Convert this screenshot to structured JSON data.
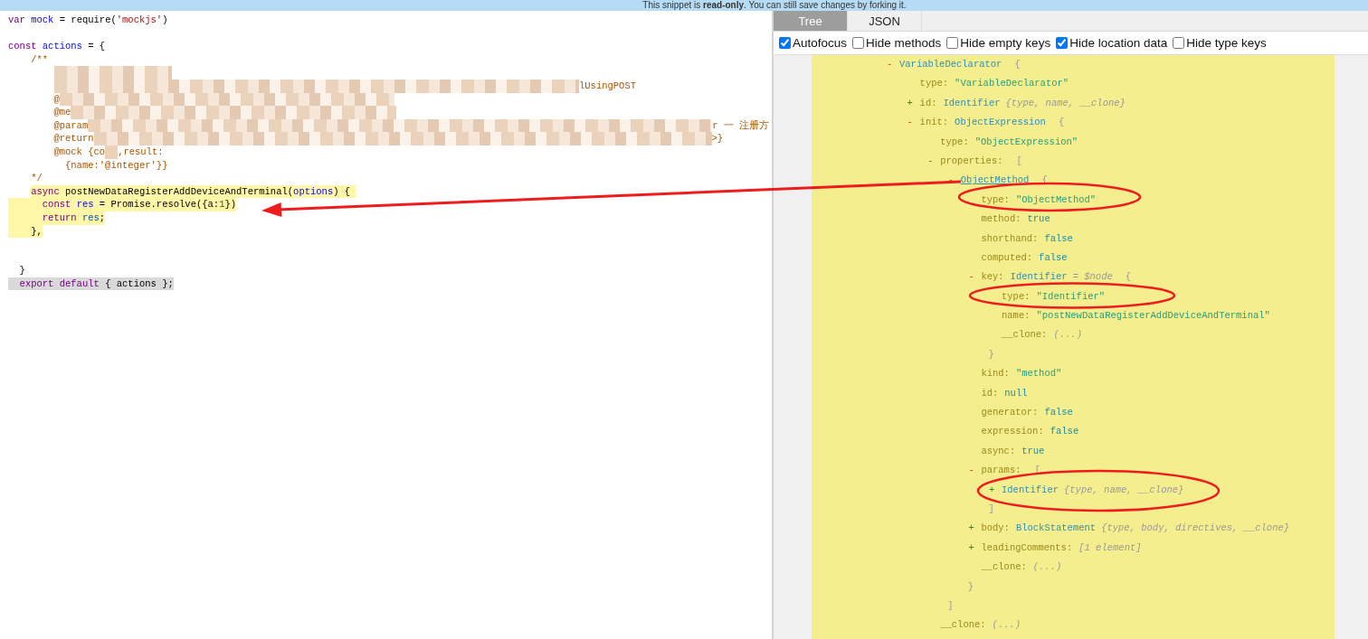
{
  "banner": {
    "text": "This snippet is **read-only**. You can still save changes by forking it."
  },
  "editor": {
    "lines": [
      {
        "kind": "code",
        "tokens": [
          {
            "kind": "keyword",
            "text": "var "
          },
          {
            "kind": "def",
            "text": "mock"
          },
          {
            "kind": "plain",
            "text": " = require("
          },
          {
            "kind": "string",
            "text": "'mockjs'"
          },
          {
            "kind": "plain",
            "text": ")"
          }
        ]
      },
      {
        "kind": "blank"
      },
      {
        "kind": "code",
        "tokens": [
          {
            "kind": "keyword",
            "text": "const "
          },
          {
            "kind": "def",
            "text": "actions"
          },
          {
            "kind": "plain",
            "text": " = {"
          }
        ]
      },
      {
        "kind": "code",
        "tokens": [
          {
            "kind": "comment",
            "text": "    /**"
          }
        ]
      },
      {
        "kind": "code",
        "tokens": [
          {
            "kind": "redacted"
          }
        ]
      },
      {
        "kind": "code",
        "tokens": [
          {
            "kind": "redacted"
          },
          {
            "kind": "comment",
            "text": "lUsingPOST"
          }
        ]
      },
      {
        "kind": "code",
        "tokens": [
          {
            "kind": "comment",
            "text": "        @"
          },
          {
            "kind": "redacted"
          }
        ]
      },
      {
        "kind": "code",
        "tokens": [
          {
            "kind": "comment",
            "text": "        @me"
          },
          {
            "kind": "redacted"
          }
        ]
      },
      {
        "kind": "code",
        "tokens": [
          {
            "kind": "comment",
            "text": "        @param"
          },
          {
            "kind": "redacted"
          },
          {
            "kind": "comment",
            "text": "r 一 注册方"
          }
        ]
      },
      {
        "kind": "code",
        "tokens": [
          {
            "kind": "comment",
            "text": "        @return"
          },
          {
            "kind": "redacted"
          },
          {
            "kind": "comment",
            "text": ">}"
          }
        ]
      },
      {
        "kind": "code",
        "tokens": [
          {
            "kind": "comment",
            "text": "        @mock {co"
          },
          {
            "kind": "redacted"
          },
          {
            "kind": "comment",
            "text": ",result:"
          }
        ]
      },
      {
        "kind": "code",
        "tokens": [
          {
            "kind": "comment",
            "text": "          {name:'@integer'}}"
          }
        ]
      },
      {
        "kind": "code",
        "tokens": [
          {
            "kind": "comment",
            "text": "    */"
          }
        ]
      },
      {
        "kind": "highlight",
        "tokens": [
          {
            "kind": "keyword",
            "text": "    async"
          },
          {
            "kind": "plain",
            "text": " postNewDataRegisterAddDeviceAndTerminal("
          },
          {
            "kind": "def",
            "text": "options"
          },
          {
            "kind": "plain",
            "text": ") { "
          }
        ]
      },
      {
        "kind": "highlight-full",
        "tokens": [
          {
            "kind": "keyword",
            "text": "      const "
          },
          {
            "kind": "def",
            "text": "res"
          },
          {
            "kind": "plain",
            "text": " = Promise.resolve({a:"
          },
          {
            "kind": "number",
            "text": "1"
          },
          {
            "kind": "plain",
            "text": "})"
          }
        ]
      },
      {
        "kind": "highlight-full",
        "tokens": [
          {
            "kind": "keyword",
            "text": "      return "
          },
          {
            "kind": "variable",
            "text": "res"
          },
          {
            "kind": "plain",
            "text": ";"
          }
        ]
      },
      {
        "kind": "highlight-full",
        "tokens": [
          {
            "kind": "plain",
            "text": "    },"
          }
        ]
      },
      {
        "kind": "blank"
      },
      {
        "kind": "blank"
      },
      {
        "kind": "code",
        "tokens": [
          {
            "kind": "plain",
            "text": "  }"
          }
        ]
      },
      {
        "kind": "selection",
        "tokens": [
          {
            "kind": "keyword",
            "text": "  export default"
          },
          {
            "kind": "plain",
            "text": " { actions };"
          }
        ]
      }
    ]
  },
  "tabs": [
    {
      "label": "Tree",
      "selected": true
    },
    {
      "label": "JSON",
      "selected": false
    }
  ],
  "options": [
    {
      "label": "Autofocus",
      "checked": true
    },
    {
      "label": "Hide methods",
      "checked": false
    },
    {
      "label": "Hide empty keys",
      "checked": false
    },
    {
      "label": "Hide location data",
      "checked": true
    },
    {
      "label": "Hide type keys",
      "checked": false
    }
  ],
  "tree": [
    {
      "toggle": "-",
      "expanded": true,
      "node_type": "VariableDeclarator",
      "open": "{",
      "children": [
        {
          "key": "type:",
          "value": "\"VariableDeclarator\"",
          "kind": "string"
        },
        {
          "toggle": "+",
          "expanded": false,
          "key": "id:",
          "node_type": "Identifier",
          "summary": "{type, name, __clone}"
        },
        {
          "toggle": "-",
          "expanded": true,
          "key": "init:",
          "node_type": "ObjectExpression",
          "open": "{",
          "children": [
            {
              "key": "type:",
              "value": "\"ObjectExpression\"",
              "kind": "string"
            },
            {
              "toggle": "-",
              "expanded": true,
              "key": "properties:",
              "open": "[",
              "close": "]",
              "children": [
                {
                  "toggle": "-",
                  "expanded": true,
                  "node_type": "ObjectMethod",
                  "hovered": true,
                  "open": "{",
                  "close": "}",
                  "children": [
                    {
                      "key": "type:",
                      "value": "\"ObjectMethod\"",
                      "kind": "string"
                    },
                    {
                      "key": "method:",
                      "value": "true",
                      "kind": "literal"
                    },
                    {
                      "key": "shorthand:",
                      "value": "false",
                      "kind": "literal"
                    },
                    {
                      "key": "computed:",
                      "value": "false",
                      "kind": "literal"
                    },
                    {
                      "toggle": "-",
                      "expanded": true,
                      "key": "key:",
                      "node_type": "Identifier",
                      "note": "= $node",
                      "open": "{",
                      "close": "}",
                      "children": [
                        {
                          "key": "type:",
                          "value": "\"Identifier\"",
                          "kind": "string"
                        },
                        {
                          "key": "name:",
                          "value": "\"postNewDataRegisterAddDeviceAndTerminal\"",
                          "kind": "string"
                        },
                        {
                          "key": "__clone:",
                          "value": "(...)",
                          "kind": "ellipsis"
                        }
                      ]
                    },
                    {
                      "key": "kind:",
                      "value": "\"method\"",
                      "kind": "string"
                    },
                    {
                      "key": "id:",
                      "value": "null",
                      "kind": "literal"
                    },
                    {
                      "key": "generator:",
                      "value": "false",
                      "kind": "literal"
                    },
                    {
                      "key": "expression:",
                      "value": "false",
                      "kind": "literal"
                    },
                    {
                      "key": "async:",
                      "value": "true",
                      "kind": "literal"
                    },
                    {
                      "toggle": "-",
                      "expanded": true,
                      "key": "params:",
                      "open": "[",
                      "close": "]",
                      "children": [
                        {
                          "toggle": "+",
                          "expanded": false,
                          "node_type": "Identifier",
                          "summary": "{type, name, __clone}"
                        }
                      ]
                    },
                    {
                      "toggle": "+",
                      "expanded": false,
                      "key": "body:",
                      "node_type": "BlockStatement",
                      "summary": "{type, body, directives, __clone}"
                    },
                    {
                      "toggle": "+",
                      "expanded": false,
                      "key": "leadingComments:",
                      "summary": "[1 element]"
                    },
                    {
                      "key": "__clone:",
                      "value": "(...)",
                      "kind": "ellipsis"
                    }
                  ]
                }
              ]
            },
            {
              "key": "__clone:",
              "value": "(...)",
              "kind": "ellipsis"
            }
          ]
        }
      ]
    }
  ],
  "annotations": [
    {
      "kind": "arrow"
    },
    {
      "kind": "ellipse"
    },
    {
      "kind": "ellipse"
    },
    {
      "kind": "ellipse"
    }
  ]
}
